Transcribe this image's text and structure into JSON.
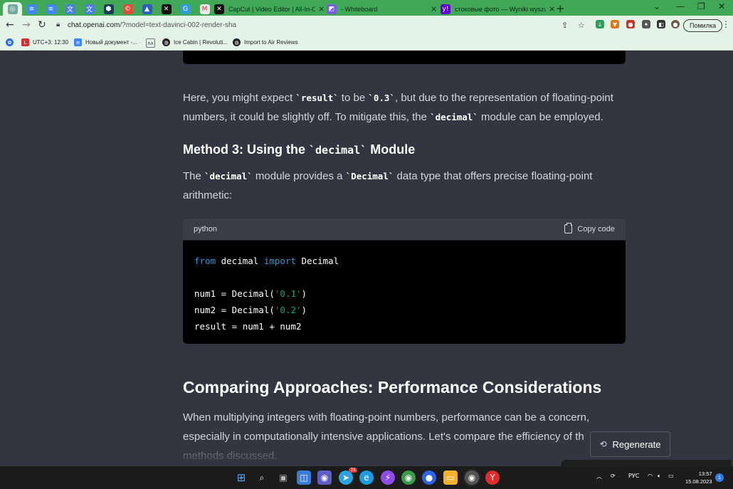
{
  "browser": {
    "tabs": [
      {
        "title": "CapCut | Video Editor | All-In-One",
        "icon": "capcut-icon"
      },
      {
        "title": "- Whiteboard",
        "icon": "whiteboard-icon"
      },
      {
        "title": "стоковые фото — Wyniki wyszukiwania",
        "icon": "yahoo-icon"
      }
    ],
    "url_host": "chat.openai.com",
    "url_path": "/?model=text-davinci-002-render-sha",
    "profile_label": "Помилка",
    "bookmarks": [
      {
        "label": "UTC+3: 12:30"
      },
      {
        "label": "Новый документ -..."
      },
      {
        "label": "Ice Cabin | Revoluti..."
      },
      {
        "label": "Import to Air Reviews"
      }
    ]
  },
  "content": {
    "para1_a": "Here, you might expect ",
    "para1_code1": "`result`",
    "para1_b": " to be ",
    "para1_code2": "`0.3`",
    "para1_c": ", but due to the representation of floating-point numbers, it could be slightly off. To mitigate this, the ",
    "para1_code3": "`decimal`",
    "para1_d": " module can be employed.",
    "heading3_a": "Method 3: Using the ",
    "heading3_code": "`decimal`",
    "heading3_b": " Module",
    "para2_a": "The ",
    "para2_code1": "`decimal`",
    "para2_b": " module provides a ",
    "para2_code2": "`Decimal`",
    "para2_c": " data type that offers precise floating-point arithmetic:",
    "code_lang": "python",
    "copy_label": "Copy code",
    "code": {
      "l1_kw1": "from",
      "l1_mod": " decimal ",
      "l1_kw2": "import",
      "l1_cls": " Decimal",
      "l3_a": "num1 = Decimal(",
      "l3_s": "'0.1'",
      "l3_b": ")",
      "l4_a": "num2 = Decimal(",
      "l4_s": "'0.2'",
      "l4_b": ")",
      "l5": "result = num1 + num2"
    },
    "heading2": "Comparing Approaches: Performance Considerations",
    "para3": "When multiplying integers with floating-point numbers, performance can be a concern, especially in computationally intensive applications. Let's compare the efficiency of th",
    "para3_end": "methods discussed.",
    "regenerate_label": "Regenerate"
  },
  "taskbar": {
    "telegram_badge": "75",
    "lang": "РУС",
    "time": "13:57",
    "date": "15.08.2023",
    "notifications": "1"
  },
  "colors": {
    "tabbar": "#40a857",
    "toolbar": "#e4f3e7",
    "page_bg": "#343541",
    "code_bg": "#000000",
    "keyword": "#2e95d3",
    "string": "#00a67d"
  }
}
